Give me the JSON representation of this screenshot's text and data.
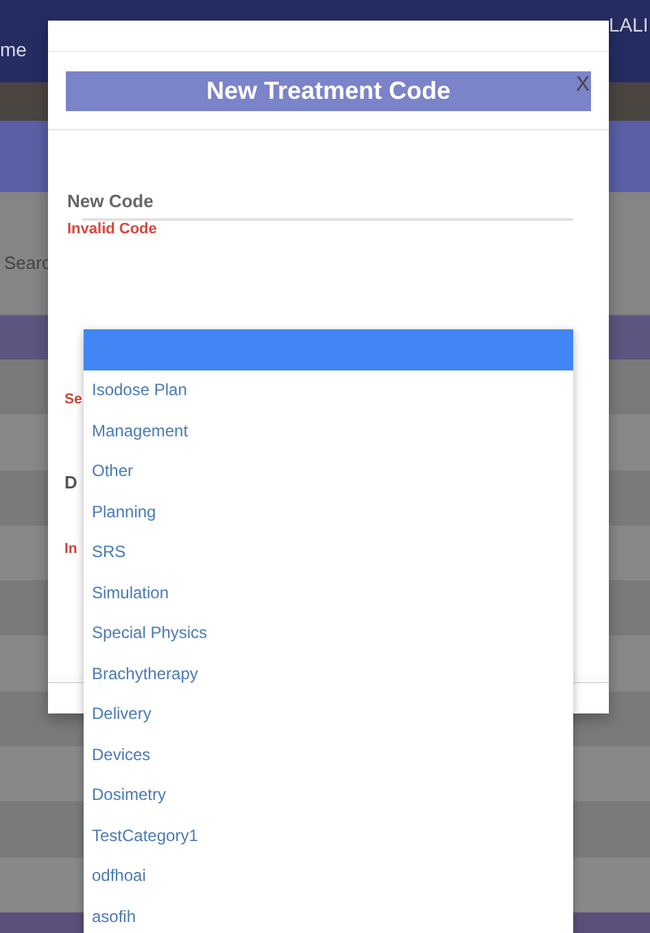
{
  "background": {
    "nav_left": "me",
    "nav_right": "LALI",
    "search_label": "Searc"
  },
  "modal": {
    "title": "New Treatment Code",
    "close": "X",
    "field": {
      "label": "New Code",
      "error": "Invalid Code"
    },
    "hidden_labels": [
      {
        "text": "Se",
        "kind": "error"
      },
      {
        "text": "D",
        "kind": "label"
      },
      {
        "text": "In",
        "kind": "error"
      }
    ]
  },
  "dropdown": {
    "blank_option": {
      "selected": true
    },
    "options": [
      {
        "label": "Isodose Plan",
        "selected": false
      },
      {
        "label": "Management",
        "selected": false
      },
      {
        "label": "Other",
        "selected": false
      },
      {
        "label": "Planning",
        "selected": false
      },
      {
        "label": "SRS",
        "selected": false
      },
      {
        "label": "Simulation",
        "selected": false
      },
      {
        "label": "Special Physics",
        "selected": false
      },
      {
        "label": "Brachytherapy",
        "selected": false
      },
      {
        "label": "Delivery",
        "selected": false
      },
      {
        "label": "Devices",
        "selected": false
      },
      {
        "label": "Dosimetry",
        "selected": false
      },
      {
        "label": "TestCategory1",
        "selected": false
      },
      {
        "label": "odfhoai",
        "selected": false
      },
      {
        "label": "asofih",
        "selected": false
      }
    ]
  }
}
